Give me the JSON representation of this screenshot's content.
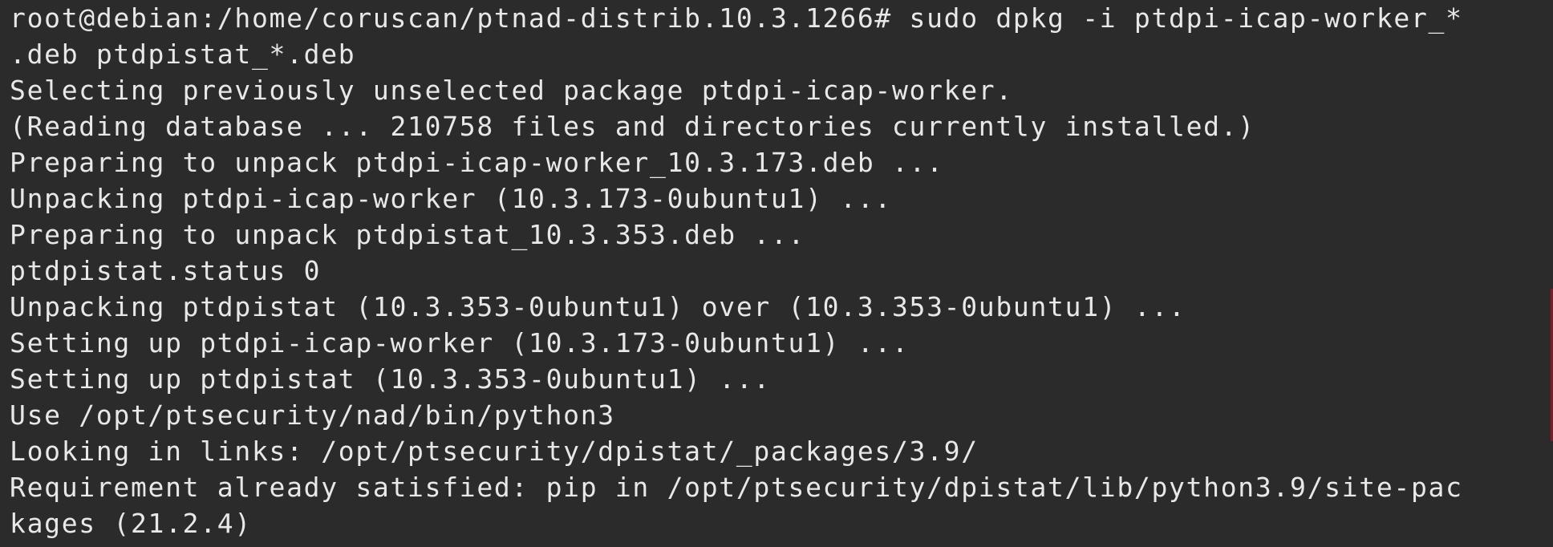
{
  "terminal": {
    "lines": [
      "root@debian:/home/coruscan/ptnad-distrib.10.3.1266# sudo dpkg -i ptdpi-icap-worker_*",
      ".deb ptdpistat_*.deb",
      "Selecting previously unselected package ptdpi-icap-worker.",
      "(Reading database ... 210758 files and directories currently installed.)",
      "Preparing to unpack ptdpi-icap-worker_10.3.173.deb ...",
      "Unpacking ptdpi-icap-worker (10.3.173-0ubuntu1) ...",
      "Preparing to unpack ptdpistat_10.3.353.deb ...",
      "ptdpistat.status 0",
      "Unpacking ptdpistat (10.3.353-0ubuntu1) over (10.3.353-0ubuntu1) ...",
      "Setting up ptdpi-icap-worker (10.3.173-0ubuntu1) ...",
      "Setting up ptdpistat (10.3.353-0ubuntu1) ...",
      "Use /opt/ptsecurity/nad/bin/python3",
      "Looking in links: /opt/ptsecurity/dpistat/_packages/3.9/",
      "Requirement already satisfied: pip in /opt/ptsecurity/dpistat/lib/python3.9/site-pac",
      "kages (21.2.4)"
    ],
    "colors": {
      "background": "#2b2b2b",
      "foreground": "#e8e8e8"
    }
  }
}
